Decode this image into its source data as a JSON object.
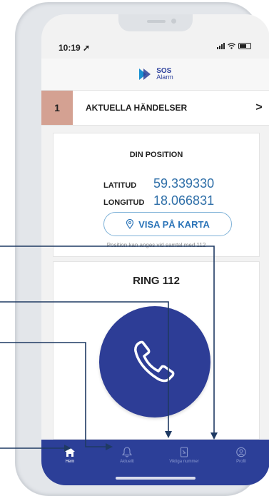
{
  "status_bar": {
    "time": "10:19"
  },
  "app": {
    "logo_name": "SOS",
    "logo_sub": "Alarm",
    "brand_color": "#2c3f98",
    "accent_color": "#1a8fd1"
  },
  "events": {
    "count": "1",
    "label": "AKTUELLA HÄNDELSER",
    "chevron": ">",
    "count_bg": "#d4a192"
  },
  "position": {
    "title": "DIN POSITION",
    "latitude_label": "LATITUD",
    "latitude_value": "59.339330",
    "longitude_label": "LONGITUD",
    "longitude_value": "18.066831",
    "map_button_label": "VISA PÅ KARTA",
    "hint": "Position kan anges vid samtal med 112"
  },
  "call": {
    "title": "RING 112",
    "icon": "phone-icon"
  },
  "nav": {
    "items": [
      {
        "label": "Hem",
        "icon": "home-icon",
        "active": true
      },
      {
        "label": "Aktuellt",
        "icon": "bell-icon",
        "active": false
      },
      {
        "label": "Viktiga nummer",
        "icon": "contacts-icon",
        "active": false
      },
      {
        "label": "Profil",
        "icon": "profile-icon",
        "active": false
      }
    ]
  }
}
